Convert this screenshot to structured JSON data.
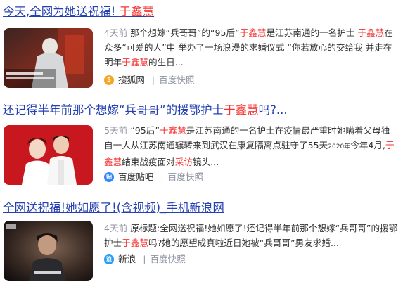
{
  "results": [
    {
      "title_pre": "今天,全网为她送祝福! ",
      "title_hl": "于鑫慧",
      "title_post": "",
      "time": "4天前",
      "snippet_html": "<span class=\"time\">4天前</span> 那个想嫁“兵哥哥”的“95后”<span class=\"hl\">于鑫慧</span>是江苏南通的一名护士 <span class=\"hl\">于鑫慧</span>在众多“可爱的人”中 举办了一场浪漫的求婚仪式 “你若放心的交给我 并走在明年<span class=\"hl\">于鑫慧</span>的生日...",
      "source": "搜狐网",
      "kuaizhao": "百度快照",
      "logo_color": "#f5a623"
    },
    {
      "title_pre": "还记得半年前那个想嫁“兵哥哥”的援鄂护士",
      "title_hl": "于鑫慧",
      "title_post": "吗?...",
      "time": "5天前",
      "snippet_html": "<span class=\"time\">5天前</span> “95后”<span class=\"hl\">于鑫慧</span>是江苏南通的一名护士在疫情最严重时她瞒着父母独自一人从江苏南通辗转来到武汉在康复隔离点驻守了55天<span style=\"font-size:9px\">2020年</span>今年4月,<span class=\"hl\">于鑫慧</span>结束战疫面对<span class=\"hl\">采访</span>镜头...",
      "source": "百度贴吧",
      "kuaizhao": "百度快照",
      "logo_color": "#3385ff"
    },
    {
      "title_pre": "全网送祝福!她如愿了!(含视频)_手机新浪网",
      "title_hl": "",
      "title_post": "",
      "time": "4天前",
      "snippet_html": "<span class=\"time\">4天前</span> 原标题:全网送祝福!她如愿了!还记得半年前那个想嫁“兵哥哥”的援鄂护士<span class=\"hl\">于鑫慧</span>吗?她的愿望成真啦近日她被“兵哥哥”男友求婚...",
      "source": "新浪",
      "kuaizhao": "百度快照",
      "logo_color": "#2a9df4"
    }
  ]
}
